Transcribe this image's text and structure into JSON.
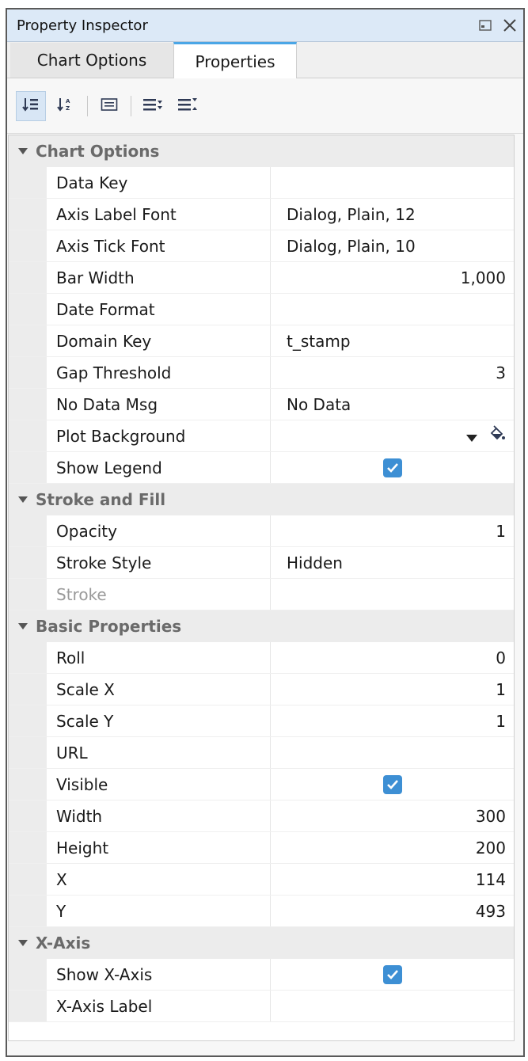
{
  "window": {
    "title": "Property Inspector"
  },
  "tabs": [
    {
      "label": "Chart Options",
      "active": false
    },
    {
      "label": "Properties",
      "active": true
    }
  ],
  "toolbar": {
    "icons": [
      "sort-category-icon",
      "sort-alphabetical-icon",
      "description-icon",
      "expand-all-icon",
      "collapse-all-icon"
    ]
  },
  "groups": [
    {
      "label": "Chart Options",
      "rows": [
        {
          "name": "Data Key",
          "value": ""
        },
        {
          "name": "Axis Label Font",
          "value": "Dialog, Plain, 12"
        },
        {
          "name": "Axis Tick Font",
          "value": "Dialog, Plain, 10"
        },
        {
          "name": "Bar Width",
          "value": "1,000"
        },
        {
          "name": "Date Format",
          "value": ""
        },
        {
          "name": "Domain Key",
          "value": "t_stamp"
        },
        {
          "name": "Gap Threshold",
          "value": "3"
        },
        {
          "name": "No Data Msg",
          "value": "No Data"
        },
        {
          "name": "Plot Background",
          "value": ""
        },
        {
          "name": "Show Legend",
          "value": "",
          "checked": true
        }
      ]
    },
    {
      "label": "Stroke and Fill",
      "rows": [
        {
          "name": "Opacity",
          "value": "1"
        },
        {
          "name": "Stroke Style",
          "value": "Hidden"
        },
        {
          "name": "Stroke",
          "value": ""
        }
      ]
    },
    {
      "label": "Basic Properties",
      "rows": [
        {
          "name": "Roll",
          "value": "0"
        },
        {
          "name": "Scale X",
          "value": "1"
        },
        {
          "name": "Scale Y",
          "value": "1"
        },
        {
          "name": "URL",
          "value": ""
        },
        {
          "name": "Visible",
          "value": "",
          "checked": true
        },
        {
          "name": "Width",
          "value": "300"
        },
        {
          "name": "Height",
          "value": "200"
        },
        {
          "name": "X",
          "value": "114"
        },
        {
          "name": "Y",
          "value": "493"
        }
      ]
    },
    {
      "label": "X-Axis",
      "rows": [
        {
          "name": "Show X-Axis",
          "value": "",
          "checked": true
        },
        {
          "name": "X-Axis Label",
          "value": ""
        }
      ]
    }
  ],
  "colors": {
    "accent": "#4aa6e6",
    "checkbox": "#3d8fd4",
    "titlebar": "#dce9f7"
  }
}
